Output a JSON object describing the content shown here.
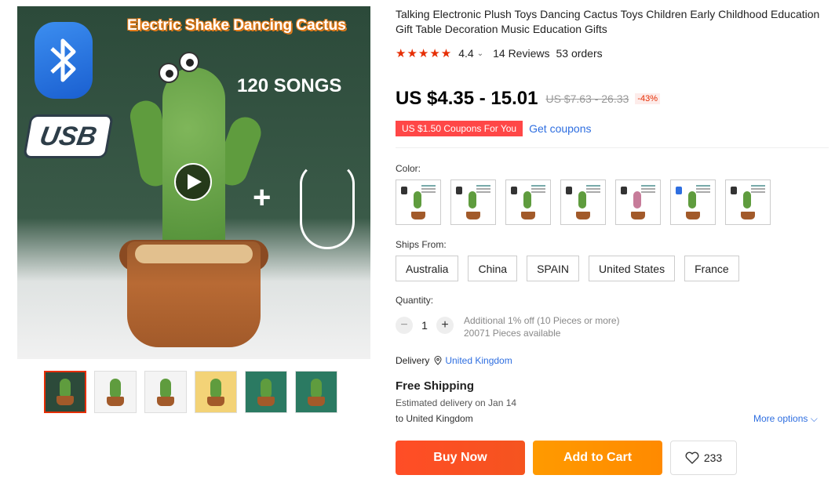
{
  "gallery": {
    "banner": "Electric Shake Dancing Cactus",
    "songs": "120 SONGS",
    "usb": "USB",
    "plus": "+",
    "thumbnails": [
      "thumb-1",
      "thumb-2",
      "thumb-3",
      "thumb-4",
      "thumb-5",
      "thumb-6"
    ],
    "selected_thumbnail": 1
  },
  "product": {
    "title": "Talking Electronic Plush Toys Dancing Cactus Toys Children Early Childhood Education Gift Table Decoration Music Education Gifts",
    "stars": "★★★★★",
    "rating": "4.4",
    "rating_chevron": "⌄",
    "reviews": "14 Reviews",
    "orders": "53 orders",
    "price": "US $4.35 - 15.01",
    "original_price": "US $7.63 - 26.33",
    "discount": "-43%",
    "coupon": "US $1.50 Coupons For You",
    "get_coupons": "Get coupons"
  },
  "options": {
    "color_label": "Color:",
    "color_swatch_count": 7,
    "ships_from_label": "Ships From:",
    "ships_from": [
      "Australia",
      "China",
      "SPAIN",
      "United States",
      "France"
    ],
    "quantity_label": "Quantity:",
    "quantity": "1",
    "minus": "−",
    "plus": "+",
    "quantity_note_1": "Additional 1% off (10 Pieces or more)",
    "quantity_note_2": "20071 Pieces available"
  },
  "shipping": {
    "delivery_label": "Delivery",
    "delivery_country": "United Kingdom",
    "free_shipping": "Free Shipping",
    "estimated": "Estimated delivery on Jan 14",
    "to": "to United Kingdom",
    "more_options": "More options ⌵"
  },
  "actions": {
    "buy_now": "Buy Now",
    "add_to_cart": "Add to Cart",
    "wishlist_count": "233"
  },
  "colors": {
    "accent_red": "#e62e04",
    "buy_now": "#ff4d26",
    "add_to_cart": "#ff9a00",
    "link_blue": "#2e6ee0"
  }
}
